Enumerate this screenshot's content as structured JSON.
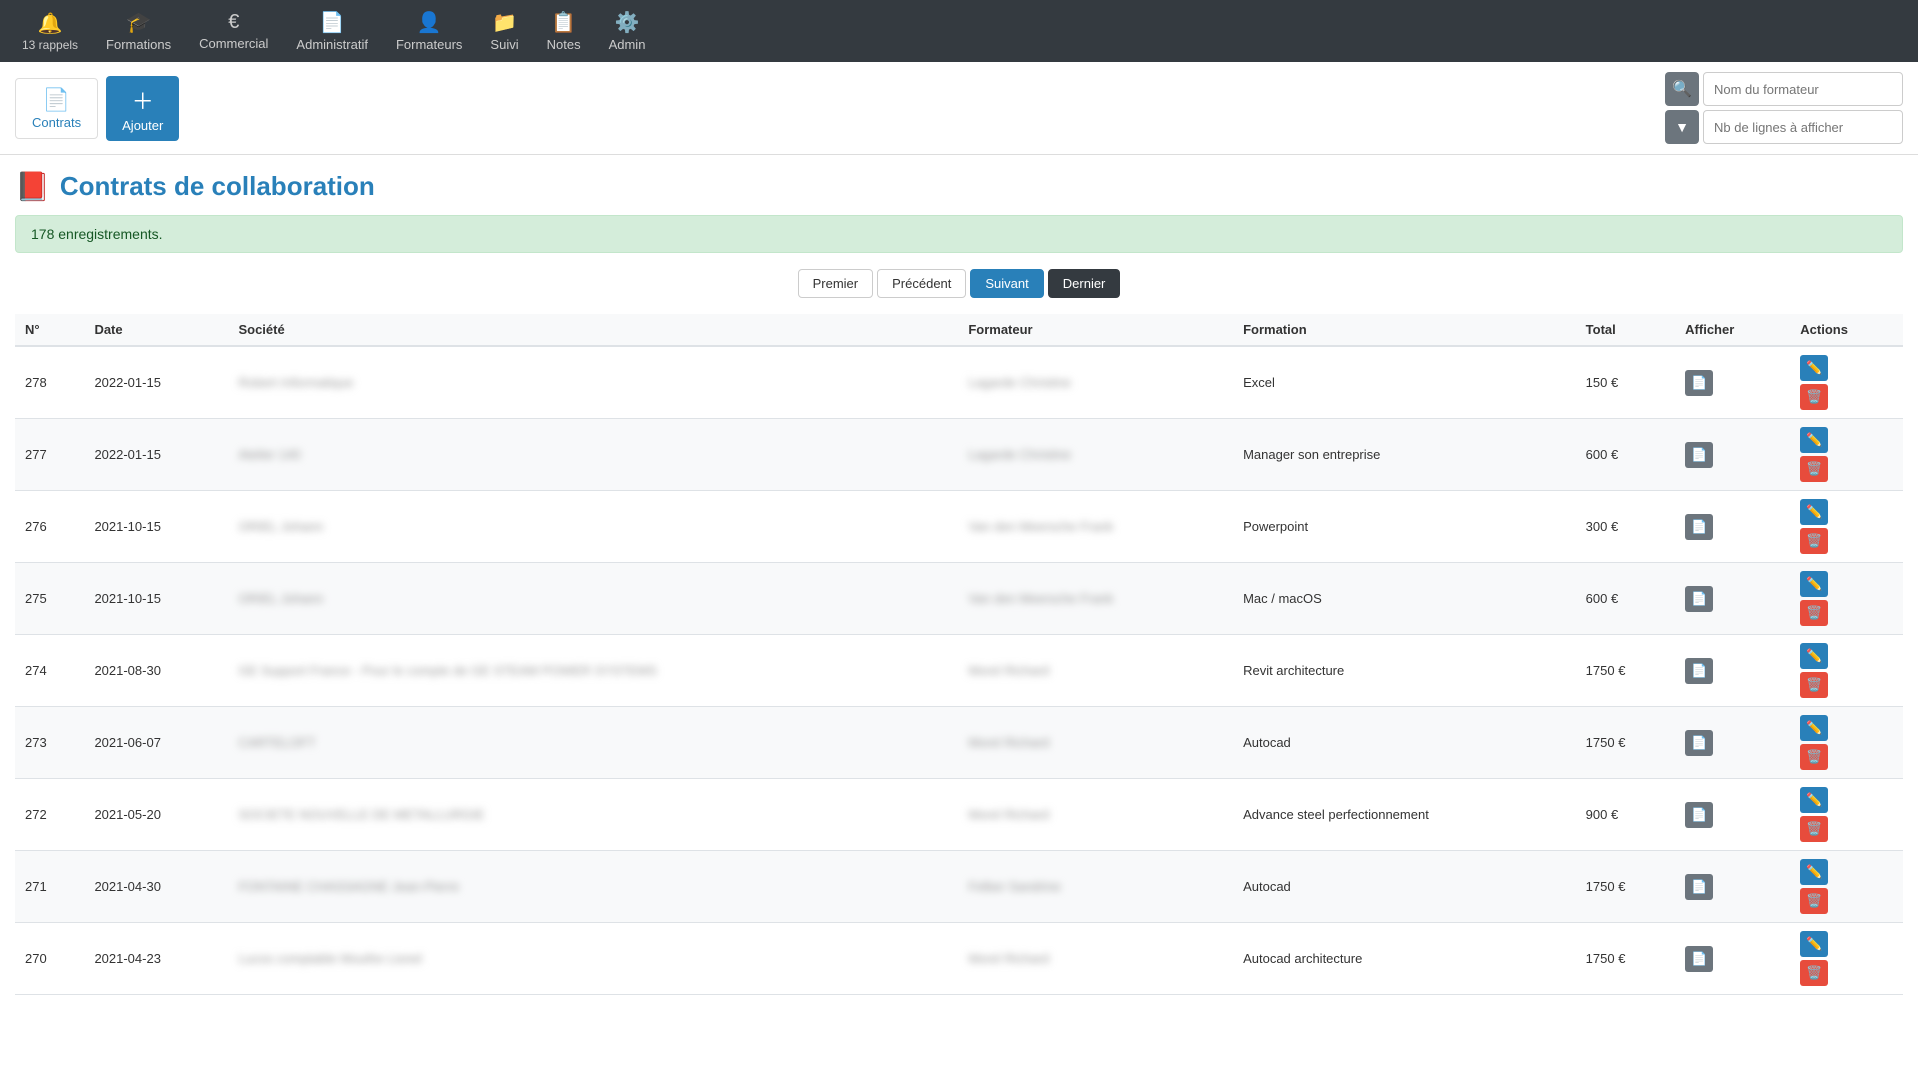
{
  "navbar": {
    "alerts": {
      "label": "13 rappels",
      "icon": "🔔"
    },
    "items": [
      {
        "id": "formations",
        "label": "Formations",
        "icon": "🎓",
        "has_dropdown": true
      },
      {
        "id": "commercial",
        "label": "Commercial",
        "icon": "€",
        "has_dropdown": true
      },
      {
        "id": "administratif",
        "label": "Administratif",
        "icon": "📄",
        "has_dropdown": true
      },
      {
        "id": "formateurs",
        "label": "Formateurs",
        "icon": "👤",
        "has_dropdown": false
      },
      {
        "id": "suivi",
        "label": "Suivi",
        "icon": "📁",
        "has_dropdown": true
      },
      {
        "id": "notes",
        "label": "Notes",
        "icon": "📋",
        "has_dropdown": true
      },
      {
        "id": "admin",
        "label": "Admin",
        "icon": "⚙️",
        "has_dropdown": true
      }
    ]
  },
  "toolbar": {
    "contrats_label": "Contrats",
    "ajouter_label": "Ajouter",
    "search_placeholder": "Nom du formateur",
    "lines_placeholder": "Nb de lignes à afficher"
  },
  "page": {
    "title": "Contrats de collaboration",
    "records_count": "178 enregistrements.",
    "pagination": {
      "premier": "Premier",
      "precedent": "Précédent",
      "suivant": "Suivant",
      "dernier": "Dernier"
    }
  },
  "table": {
    "headers": [
      "N°",
      "Date",
      "Société",
      "Formateur",
      "Formation",
      "Total",
      "Afficher",
      "Actions"
    ],
    "rows": [
      {
        "num": "278",
        "date": "2022-01-15",
        "societe": "Robert Informatique",
        "formateur": "Lagarde Christine",
        "formation": "Excel",
        "total": "150 €",
        "blurred": true
      },
      {
        "num": "277",
        "date": "2022-01-15",
        "societe": "Atelier 140",
        "formateur": "Lagarde Christine",
        "formation": "Manager son entreprise",
        "total": "600 €",
        "blurred": true
      },
      {
        "num": "276",
        "date": "2021-10-15",
        "societe": "ORIEL Johann",
        "formateur": "Van den Meersche Frank",
        "formation": "Powerpoint",
        "total": "300 €",
        "blurred": true
      },
      {
        "num": "275",
        "date": "2021-10-15",
        "societe": "ORIEL Johann",
        "formateur": "Van den Meersche Frank",
        "formation": "Mac / macOS",
        "total": "600 €",
        "blurred": true
      },
      {
        "num": "274",
        "date": "2021-08-30",
        "societe": "GE Support France - Pour le compte de GE STEAM POWER SYSTEMS",
        "formateur": "Morel Richard",
        "formation": "Revit architecture",
        "total": "1750 €",
        "blurred": true
      },
      {
        "num": "273",
        "date": "2021-06-07",
        "societe": "CARTELOFT",
        "formateur": "Morel Richard",
        "formation": "Autocad",
        "total": "1750 €",
        "blurred": true
      },
      {
        "num": "272",
        "date": "2021-05-20",
        "societe": "SOCIETE NOUVELLE DE METALLURGIE",
        "formateur": "Morel Richard",
        "formation": "Advance steel perfectionnement",
        "total": "900 €",
        "blurred": true
      },
      {
        "num": "271",
        "date": "2021-04-30",
        "societe": "FONTAINE CHASSAGNE Jean-Pierre",
        "formateur": "Felber Sandrine",
        "formation": "Autocad",
        "total": "1750 €",
        "blurred": true
      },
      {
        "num": "270",
        "date": "2021-04-23",
        "societe": "Lucos comptable Mouthe Lionel",
        "formateur": "Morel Richard",
        "formation": "Autocad architecture",
        "total": "1750 €",
        "blurred": true
      }
    ]
  }
}
